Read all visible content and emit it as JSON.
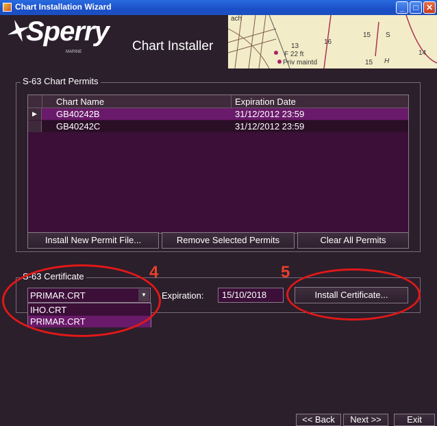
{
  "window": {
    "title": "Chart Installation Wizard",
    "controls": {
      "minimize": "_",
      "maximize": "□",
      "close": "✕"
    }
  },
  "header": {
    "brand": "Sperry",
    "brand_sub": "MARINE",
    "app_title": "Chart Installer",
    "map_labels": [
      "ach",
      "13",
      "16",
      "15",
      "S",
      "14",
      "F 22 ft",
      "Priv maintd",
      "15",
      "H"
    ]
  },
  "permits": {
    "group_title": "S-63 Chart Permits",
    "columns": [
      "Chart Name",
      "Expiration Date"
    ],
    "rows": [
      {
        "chart_name": "GB40242B",
        "expiration": "31/12/2012 23:59",
        "selected": true
      },
      {
        "chart_name": "GB40242C",
        "expiration": "31/12/2012 23:59",
        "selected": false
      }
    ],
    "buttons": {
      "install": "Install New Permit File...",
      "remove": "Remove Selected Permits",
      "clear": "Clear All Permits"
    }
  },
  "certificate": {
    "group_title": "S-63 Certificate",
    "selected": "PRIMAR.CRT",
    "options": [
      "IHO.CRT",
      "PRIMAR.CRT"
    ],
    "expiration_label": "Expiration:",
    "expiration_value": "15/10/2018",
    "install_button": "Install Certificate..."
  },
  "annotations": {
    "marker_4": "4",
    "marker_5": "5",
    "color": "#e01818"
  },
  "footer": {
    "back": "<< Back",
    "next": "Next >>",
    "exit": "Exit"
  },
  "colors": {
    "panel": "#2b1f2b",
    "grid_bg": "#3b0f38",
    "row_selected": "#6a1a6a",
    "row_dark": "#2a0f26"
  }
}
